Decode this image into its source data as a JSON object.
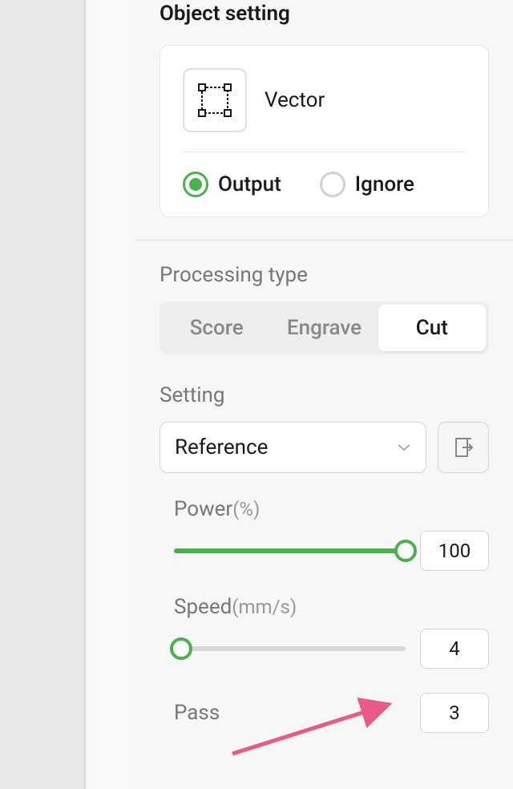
{
  "objectSetting": {
    "title": "Object setting",
    "vectorLabel": "Vector",
    "outputOptions": {
      "output": "Output",
      "ignore": "Ignore",
      "selected": "output"
    }
  },
  "processingType": {
    "title": "Processing type",
    "options": {
      "score": "Score",
      "engrave": "Engrave",
      "cut": "Cut"
    },
    "selected": "cut"
  },
  "setting": {
    "title": "Setting",
    "dropdownValue": "Reference"
  },
  "params": {
    "power": {
      "label": "Power",
      "unit": "(%)",
      "value": "100",
      "percent": 100
    },
    "speed": {
      "label": "Speed",
      "unit": "(mm/s)",
      "value": "4",
      "percent": 3
    },
    "pass": {
      "label": "Pass",
      "value": "3"
    }
  }
}
